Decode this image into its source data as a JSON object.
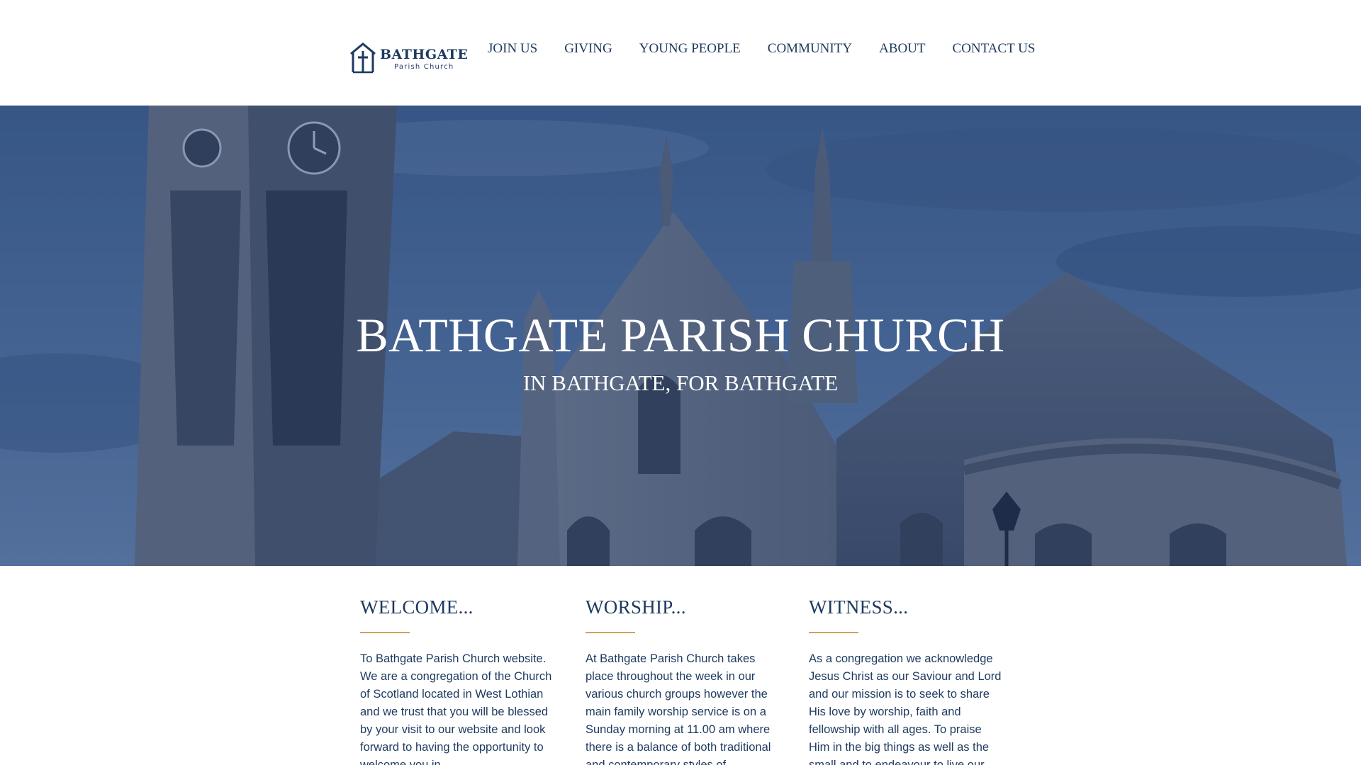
{
  "header": {
    "logo": {
      "name": "BATHGATE",
      "subtitle": "Parish Church",
      "icon": "church-cross-icon"
    },
    "nav": [
      {
        "label": "JOIN US"
      },
      {
        "label": "GIVING"
      },
      {
        "label": "YOUNG PEOPLE"
      },
      {
        "label": "COMMUNITY"
      },
      {
        "label": "ABOUT"
      },
      {
        "label": "CONTACT US"
      }
    ]
  },
  "hero": {
    "title": "BATHGATE PARISH CHURCH",
    "subtitle": "IN BATHGATE, FOR BATHGATE"
  },
  "columns": [
    {
      "heading": "WELCOME...",
      "body": "To Bathgate Parish Church website. We are a congregation of the Church of Scotland located in West Lothian and we trust that you will be blessed by your visit to our website and look forward to having the opportunity to welcome you in"
    },
    {
      "heading": "WORSHIP...",
      "body": "At Bathgate Parish Church takes place throughout the week in our various church groups however the main family worship service is on a Sunday morning at 11.00 am where there is a balance of both traditional and contemporary styles of"
    },
    {
      "heading": "WITNESS...",
      "body": "As a congregation we acknowledge Jesus Christ as our Saviour and Lord and our mission is to seek to share His love by worship, faith and fellowship with all ages. To praise Him in the big things as well as the small and to endeavour to live our"
    }
  ],
  "colors": {
    "brand_navy": "#1d3a5f",
    "accent_gold": "#c9a35f",
    "hero_overlay": "#1d3a6e"
  }
}
